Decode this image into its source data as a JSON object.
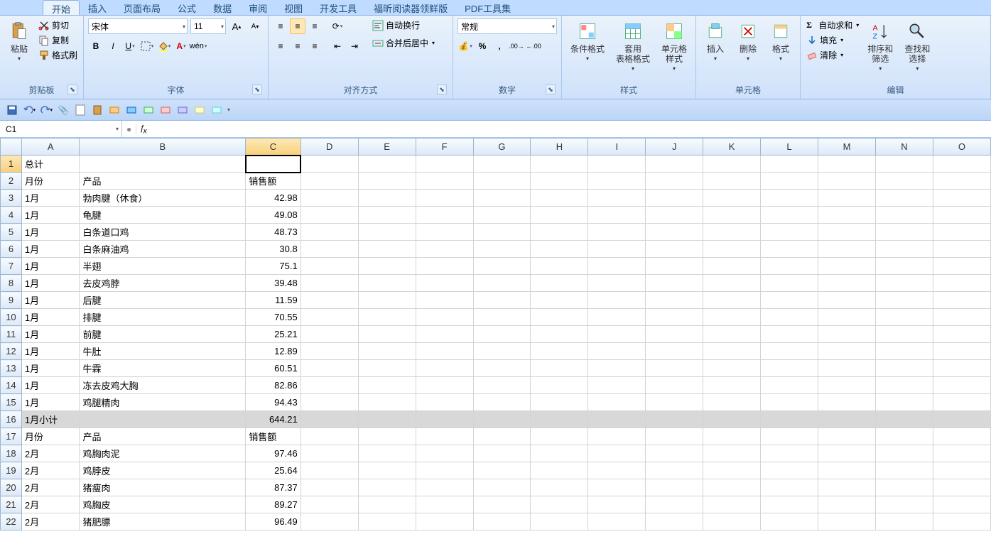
{
  "tabs": [
    "开始",
    "插入",
    "页面布局",
    "公式",
    "数据",
    "审阅",
    "视图",
    "开发工具",
    "福昕阅读器领鲜版",
    "PDF工具集"
  ],
  "active_tab": 0,
  "groups": {
    "clipboard": {
      "title": "剪贴板",
      "paste": "粘贴",
      "cut": "剪切",
      "copy": "复制",
      "painter": "格式刷"
    },
    "font": {
      "title": "字体",
      "name": "宋体",
      "size": "11"
    },
    "align": {
      "title": "对齐方式",
      "wrap": "自动换行",
      "merge": "合并后居中"
    },
    "number": {
      "title": "数字",
      "format": "常规"
    },
    "styles": {
      "title": "样式",
      "cond": "条件格式",
      "table": "套用\n表格格式",
      "cell": "单元格\n样式"
    },
    "cells": {
      "title": "单元格",
      "insert": "插入",
      "delete": "删除",
      "format": "格式"
    },
    "editing": {
      "title": "编辑",
      "sum": "自动求和",
      "fill": "填充",
      "clear": "清除",
      "sort": "排序和\n筛选",
      "find": "查找和\n选择"
    }
  },
  "name_box": "C1",
  "formula": "",
  "columns": [
    "A",
    "B",
    "C",
    "D",
    "E",
    "F",
    "G",
    "H",
    "I",
    "J",
    "K",
    "L",
    "M",
    "N",
    "O"
  ],
  "active_col": 2,
  "rows": [
    {
      "n": 1,
      "A": "总计",
      "B": "",
      "C": ""
    },
    {
      "n": 2,
      "A": "月份",
      "B": "产品",
      "C": "销售额",
      "text": true
    },
    {
      "n": 3,
      "A": "1月",
      "B": "勃肉腱（休食）",
      "C": "42.98"
    },
    {
      "n": 4,
      "A": "1月",
      "B": "龟腱",
      "C": "49.08"
    },
    {
      "n": 5,
      "A": "1月",
      "B": "白条道口鸡",
      "C": "48.73"
    },
    {
      "n": 6,
      "A": "1月",
      "B": "白条麻油鸡",
      "C": "30.8"
    },
    {
      "n": 7,
      "A": "1月",
      "B": "半翅",
      "C": "75.1"
    },
    {
      "n": 8,
      "A": "1月",
      "B": "去皮鸡脖",
      "C": "39.48"
    },
    {
      "n": 9,
      "A": "1月",
      "B": "后腱",
      "C": "11.59"
    },
    {
      "n": 10,
      "A": "1月",
      "B": "排腱",
      "C": "70.55"
    },
    {
      "n": 11,
      "A": "1月",
      "B": "前腱",
      "C": "25.21"
    },
    {
      "n": 12,
      "A": "1月",
      "B": "牛肚",
      "C": "12.89"
    },
    {
      "n": 13,
      "A": "1月",
      "B": "牛霖",
      "C": "60.51"
    },
    {
      "n": 14,
      "A": "1月",
      "B": "冻去皮鸡大胸",
      "C": "82.86"
    },
    {
      "n": 15,
      "A": "1月",
      "B": "鸡腿精肉",
      "C": "94.43"
    },
    {
      "n": 16,
      "A": "1月小计",
      "B": "",
      "C": "644.21",
      "hl": true
    },
    {
      "n": 17,
      "A": "月份",
      "B": "产品",
      "C": "销售额",
      "text": true
    },
    {
      "n": 18,
      "A": "2月",
      "B": "鸡胸肉泥",
      "C": "97.46"
    },
    {
      "n": 19,
      "A": "2月",
      "B": "鸡脖皮",
      "C": "25.64"
    },
    {
      "n": 20,
      "A": "2月",
      "B": "猪瘦肉",
      "C": "87.37"
    },
    {
      "n": 21,
      "A": "2月",
      "B": "鸡胸皮",
      "C": "89.27"
    },
    {
      "n": 22,
      "A": "2月",
      "B": "猪肥膘",
      "C": "96.49"
    }
  ],
  "selected_cell": {
    "row": 1,
    "col": "C"
  }
}
